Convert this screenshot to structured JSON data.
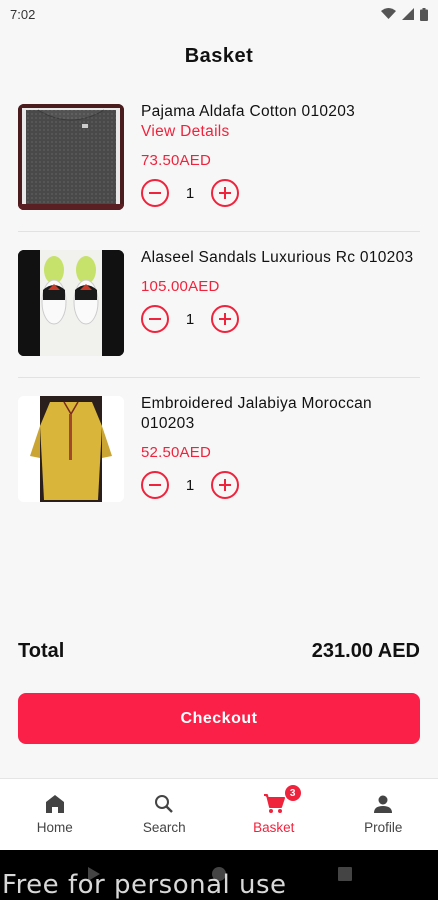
{
  "status_bar": {
    "time": "7:02"
  },
  "header": {
    "title": "Basket"
  },
  "items": [
    {
      "name": "Pajama Aldafa Cotton 010203",
      "link": "View Details",
      "price": "73.50AED",
      "qty": "1"
    },
    {
      "name": "Alaseel Sandals Luxurious Rc 010203",
      "price": "105.00AED",
      "qty": "1"
    },
    {
      "name": "Embroidered Jalabiya Moroccan 010203",
      "price": "52.50AED",
      "qty": "1"
    }
  ],
  "total": {
    "label": "Total",
    "value": "231.00 AED"
  },
  "checkout": {
    "label": "Checkout"
  },
  "tabs": [
    {
      "label": "Home",
      "icon": "home-icon"
    },
    {
      "label": "Search",
      "icon": "search-icon"
    },
    {
      "label": "Basket",
      "icon": "cart-icon",
      "badge": "3",
      "active": true
    },
    {
      "label": "Profile",
      "icon": "person-icon"
    }
  ],
  "watermark": "Free for personal use",
  "colors": {
    "accent": "#f0233d",
    "button": "#fa2047",
    "background": "#f7f7f7"
  }
}
